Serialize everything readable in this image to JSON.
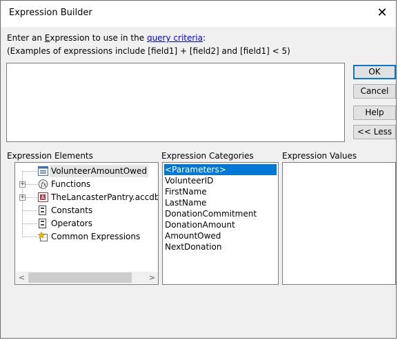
{
  "window": {
    "title": "Expression Builder",
    "close_glyph": "✕"
  },
  "prompt": {
    "line1_prefix": "Enter an ",
    "line1_mnemonic": "E",
    "line1_mid": "xpression to use in the ",
    "line1_link": "query criteria",
    "line1_suffix": ":",
    "line2": "(Examples of expressions include [field1] + [field2] and [field1] < 5)"
  },
  "expression_value": "",
  "buttons": {
    "ok": "OK",
    "cancel": "Cancel",
    "help": "Help",
    "less": "<< Less"
  },
  "elements_panel": {
    "label": "Expression Elements",
    "items": [
      {
        "label": "VolunteerAmountOwed",
        "icon": "form-icon",
        "expandable": false,
        "selected": true
      },
      {
        "label": "Functions",
        "icon": "function-icon",
        "expandable": true,
        "selected": false
      },
      {
        "label": "TheLancasterPantry.accdb",
        "icon": "database-icon",
        "expandable": true,
        "selected": false
      },
      {
        "label": "Constants",
        "icon": "constants-icon",
        "expandable": false,
        "selected": false
      },
      {
        "label": "Operators",
        "icon": "operators-icon",
        "expandable": false,
        "selected": false
      },
      {
        "label": "Common Expressions",
        "icon": "common-expressions-icon",
        "expandable": false,
        "selected": false
      }
    ],
    "scroll_left": "<",
    "scroll_right": ">"
  },
  "categories_panel": {
    "label": "Expression Categories",
    "items": [
      "<Parameters>",
      "VolunteerID",
      "FirstName",
      "LastName",
      "DonationCommitment",
      "DonationAmount",
      "AmountOwed",
      "NextDonation"
    ],
    "selected_index": 0
  },
  "values_panel": {
    "label": "Expression Values",
    "items": []
  },
  "colors": {
    "selection": "#0078d7",
    "link": "#0000ee",
    "dialog_bg": "#f0f0f0"
  }
}
